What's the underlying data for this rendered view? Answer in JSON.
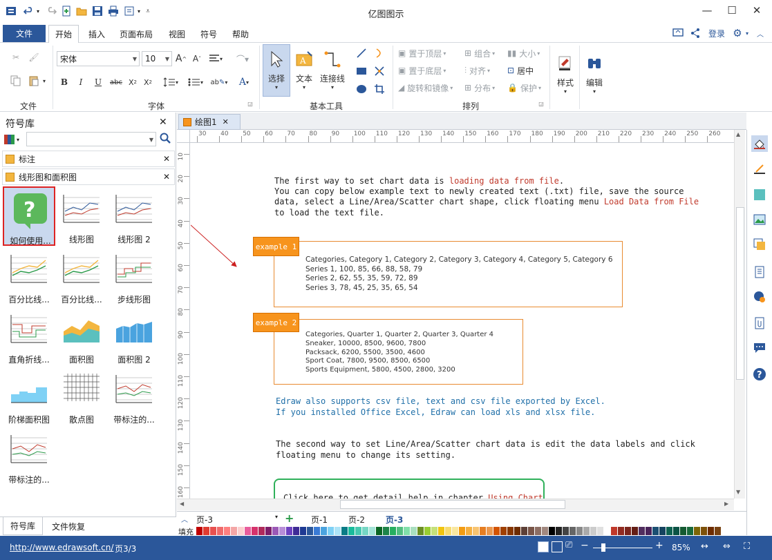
{
  "app": {
    "title": "亿图图示"
  },
  "menu": {
    "file": "文件",
    "tabs": [
      "开始",
      "插入",
      "页面布局",
      "视图",
      "符号",
      "帮助"
    ],
    "login": "登录"
  },
  "ribbon": {
    "groups": {
      "file": "文件",
      "font": "字体",
      "basic_tools": "基本工具",
      "arrange": "排列"
    },
    "font_name": "宋体",
    "font_size": "10",
    "tools": {
      "select": "选择",
      "text": "文本",
      "connector": "连接线"
    },
    "arrange": {
      "bring_front": "置于顶层",
      "send_back": "置于底层",
      "rotate_mirror": "旋转和镜像",
      "group": "组合",
      "align": "对齐",
      "distribute": "分布",
      "size": "大小",
      "center": "居中",
      "protect": "保护"
    },
    "style": "样式",
    "edit": "编辑"
  },
  "library": {
    "title": "符号库",
    "search_placeholder": "",
    "sections": [
      "标注",
      "线形图和面积图"
    ],
    "shapes": [
      "如何使用...",
      "线形图",
      "线形图 2",
      "百分比线...",
      "百分比线...",
      "步线形图",
      "直角折线...",
      "面积图",
      "面积图 2",
      "阶梯面积图",
      "散点图",
      "带标注的...",
      "带标注的..."
    ],
    "bottom_tabs": [
      "符号库",
      "文件恢复"
    ]
  },
  "document": {
    "tab": "绘图1"
  },
  "ruler": {
    "h": [
      "30",
      "40",
      "50",
      "60",
      "70",
      "80",
      "90",
      "100",
      "110",
      "120",
      "130",
      "140",
      "150",
      "160",
      "170",
      "180",
      "190",
      "200",
      "210",
      "220",
      "230",
      "240",
      "250",
      "260"
    ],
    "v": [
      "10",
      "20",
      "30",
      "40",
      "50",
      "60",
      "70",
      "80",
      "90",
      "100",
      "110",
      "120",
      "130",
      "140",
      "150",
      "160"
    ]
  },
  "canvas": {
    "intro_l1a": "The first way to set chart data is ",
    "intro_l1b": "loading data from file",
    "intro_l1c": ".",
    "intro_l2": "You can copy below example text to newly created text (.txt) file, save the source",
    "intro_l3a": "data, select a Line/Area/Scatter chart shape, click floating menu ",
    "intro_l3b": "Load Data from File",
    "intro_l4": "to load the text file.",
    "example1_label": "example 1",
    "example1_lines": [
      "Categories, Category 1, Category 2, Category 3, Category 4, Category 5, Category 6",
      "Series 1, 100, 85, 66, 88, 58, 79",
      "Series 2, 62, 55, 35, 59, 72, 89",
      "Series 3, 78, 45, 25, 35, 65, 54"
    ],
    "example2_label": "example 2",
    "example2_lines": [
      "Categories, Quarter 1, Quarter 2, Quarter 3, Quarter 4",
      "Sneaker, 10000, 8500, 9600, 7800",
      "Packsack, 6200, 5500, 3500, 4600",
      "Sport Coat, 7800, 9500, 8500, 6500",
      "Sports Equipment, 5800, 4500, 2800, 3200"
    ],
    "csv_l1": "Edraw also supports csv file, text and csv file exported by Excel.",
    "csv_l2": "If you installed Office Excel, Edraw can load xls and xlsx file.",
    "second_l1": "The second way to set Line/Area/Scatter chart data is edit the data labels and click",
    "second_l2": "floating menu to change its setting.",
    "help_a": "Click here to get detail help in chapter ",
    "help_b": "Using Chart"
  },
  "pages": {
    "current": "页-3",
    "tabs": [
      "页-1",
      "页-2",
      "页-3"
    ],
    "active": "页-3"
  },
  "fill_label": "填充",
  "status": {
    "url": "http://www.edrawsoft.cn/",
    "page": "页3/3",
    "zoom": "85%"
  },
  "colors": {
    "accent": "#2b579a",
    "orange": "#f7941d",
    "link_red": "#c0392b",
    "teal_text": "#1f6fa8"
  }
}
